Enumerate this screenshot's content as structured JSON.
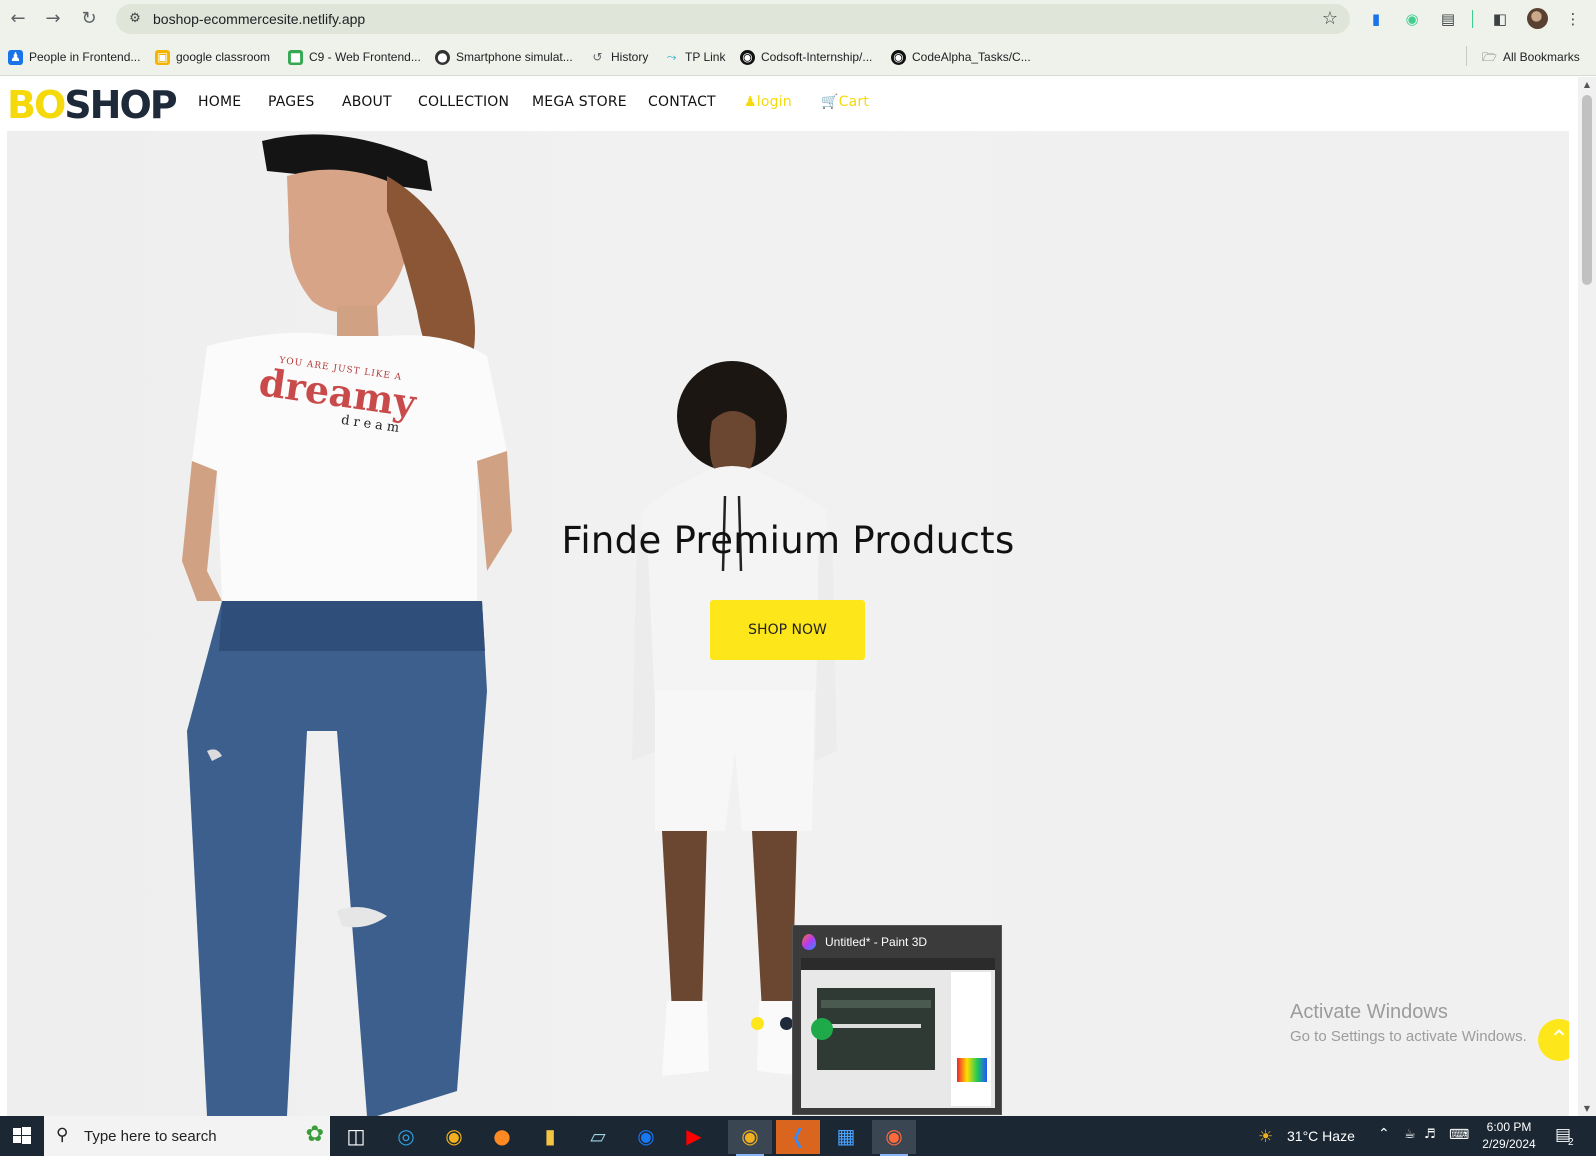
{
  "browser": {
    "url": "boshop-ecommercesite.netlify.app",
    "bookmarks": [
      {
        "label": "People in Frontend...",
        "color": "#1a73e8",
        "glyph": "♟"
      },
      {
        "label": "google classroom",
        "color": "#f4b400",
        "glyph": "▣"
      },
      {
        "label": "C9 - Web Frontend...",
        "color": "#34a853",
        "glyph": "■"
      },
      {
        "label": "Smartphone simulat...",
        "color": "#333333",
        "glyph": "●"
      },
      {
        "label": "History",
        "color": "#5f6368",
        "glyph": "↺"
      },
      {
        "label": "TP Link",
        "color": "#1fa3c9",
        "glyph": "↑"
      },
      {
        "label": "Codsoft-Internship/...",
        "color": "#111111",
        "glyph": "◉"
      },
      {
        "label": "CodeAlpha_Tasks/C...",
        "color": "#111111",
        "glyph": "◉"
      }
    ],
    "all_bookmarks": "All Bookmarks"
  },
  "site": {
    "logo_bo": "BO",
    "logo_shop": "SHOP",
    "menu": [
      "HOME",
      "PAGES",
      "ABOUT",
      "COLLECTION",
      "MEGA STORE",
      "CONTACT"
    ],
    "login": "login",
    "cart": "Cart",
    "hero_title": "Finde Premium Products",
    "shop_now": "SHOP NOW",
    "tshirt_line1": "YOU ARE JUST LIKE A",
    "tshirt_line2": "dreamy",
    "tshirt_line3": "dream",
    "accent_color": "#fde71b"
  },
  "overlay": {
    "activate_title": "Activate Windows",
    "activate_sub": "Go to Settings to activate Windows.",
    "preview_title": "Untitled* - Paint 3D"
  },
  "taskbar": {
    "search_placeholder": "Type here to search",
    "weather": "31°C  Haze",
    "time": "6:00 PM",
    "date": "2/29/2024",
    "notifications": "2"
  }
}
